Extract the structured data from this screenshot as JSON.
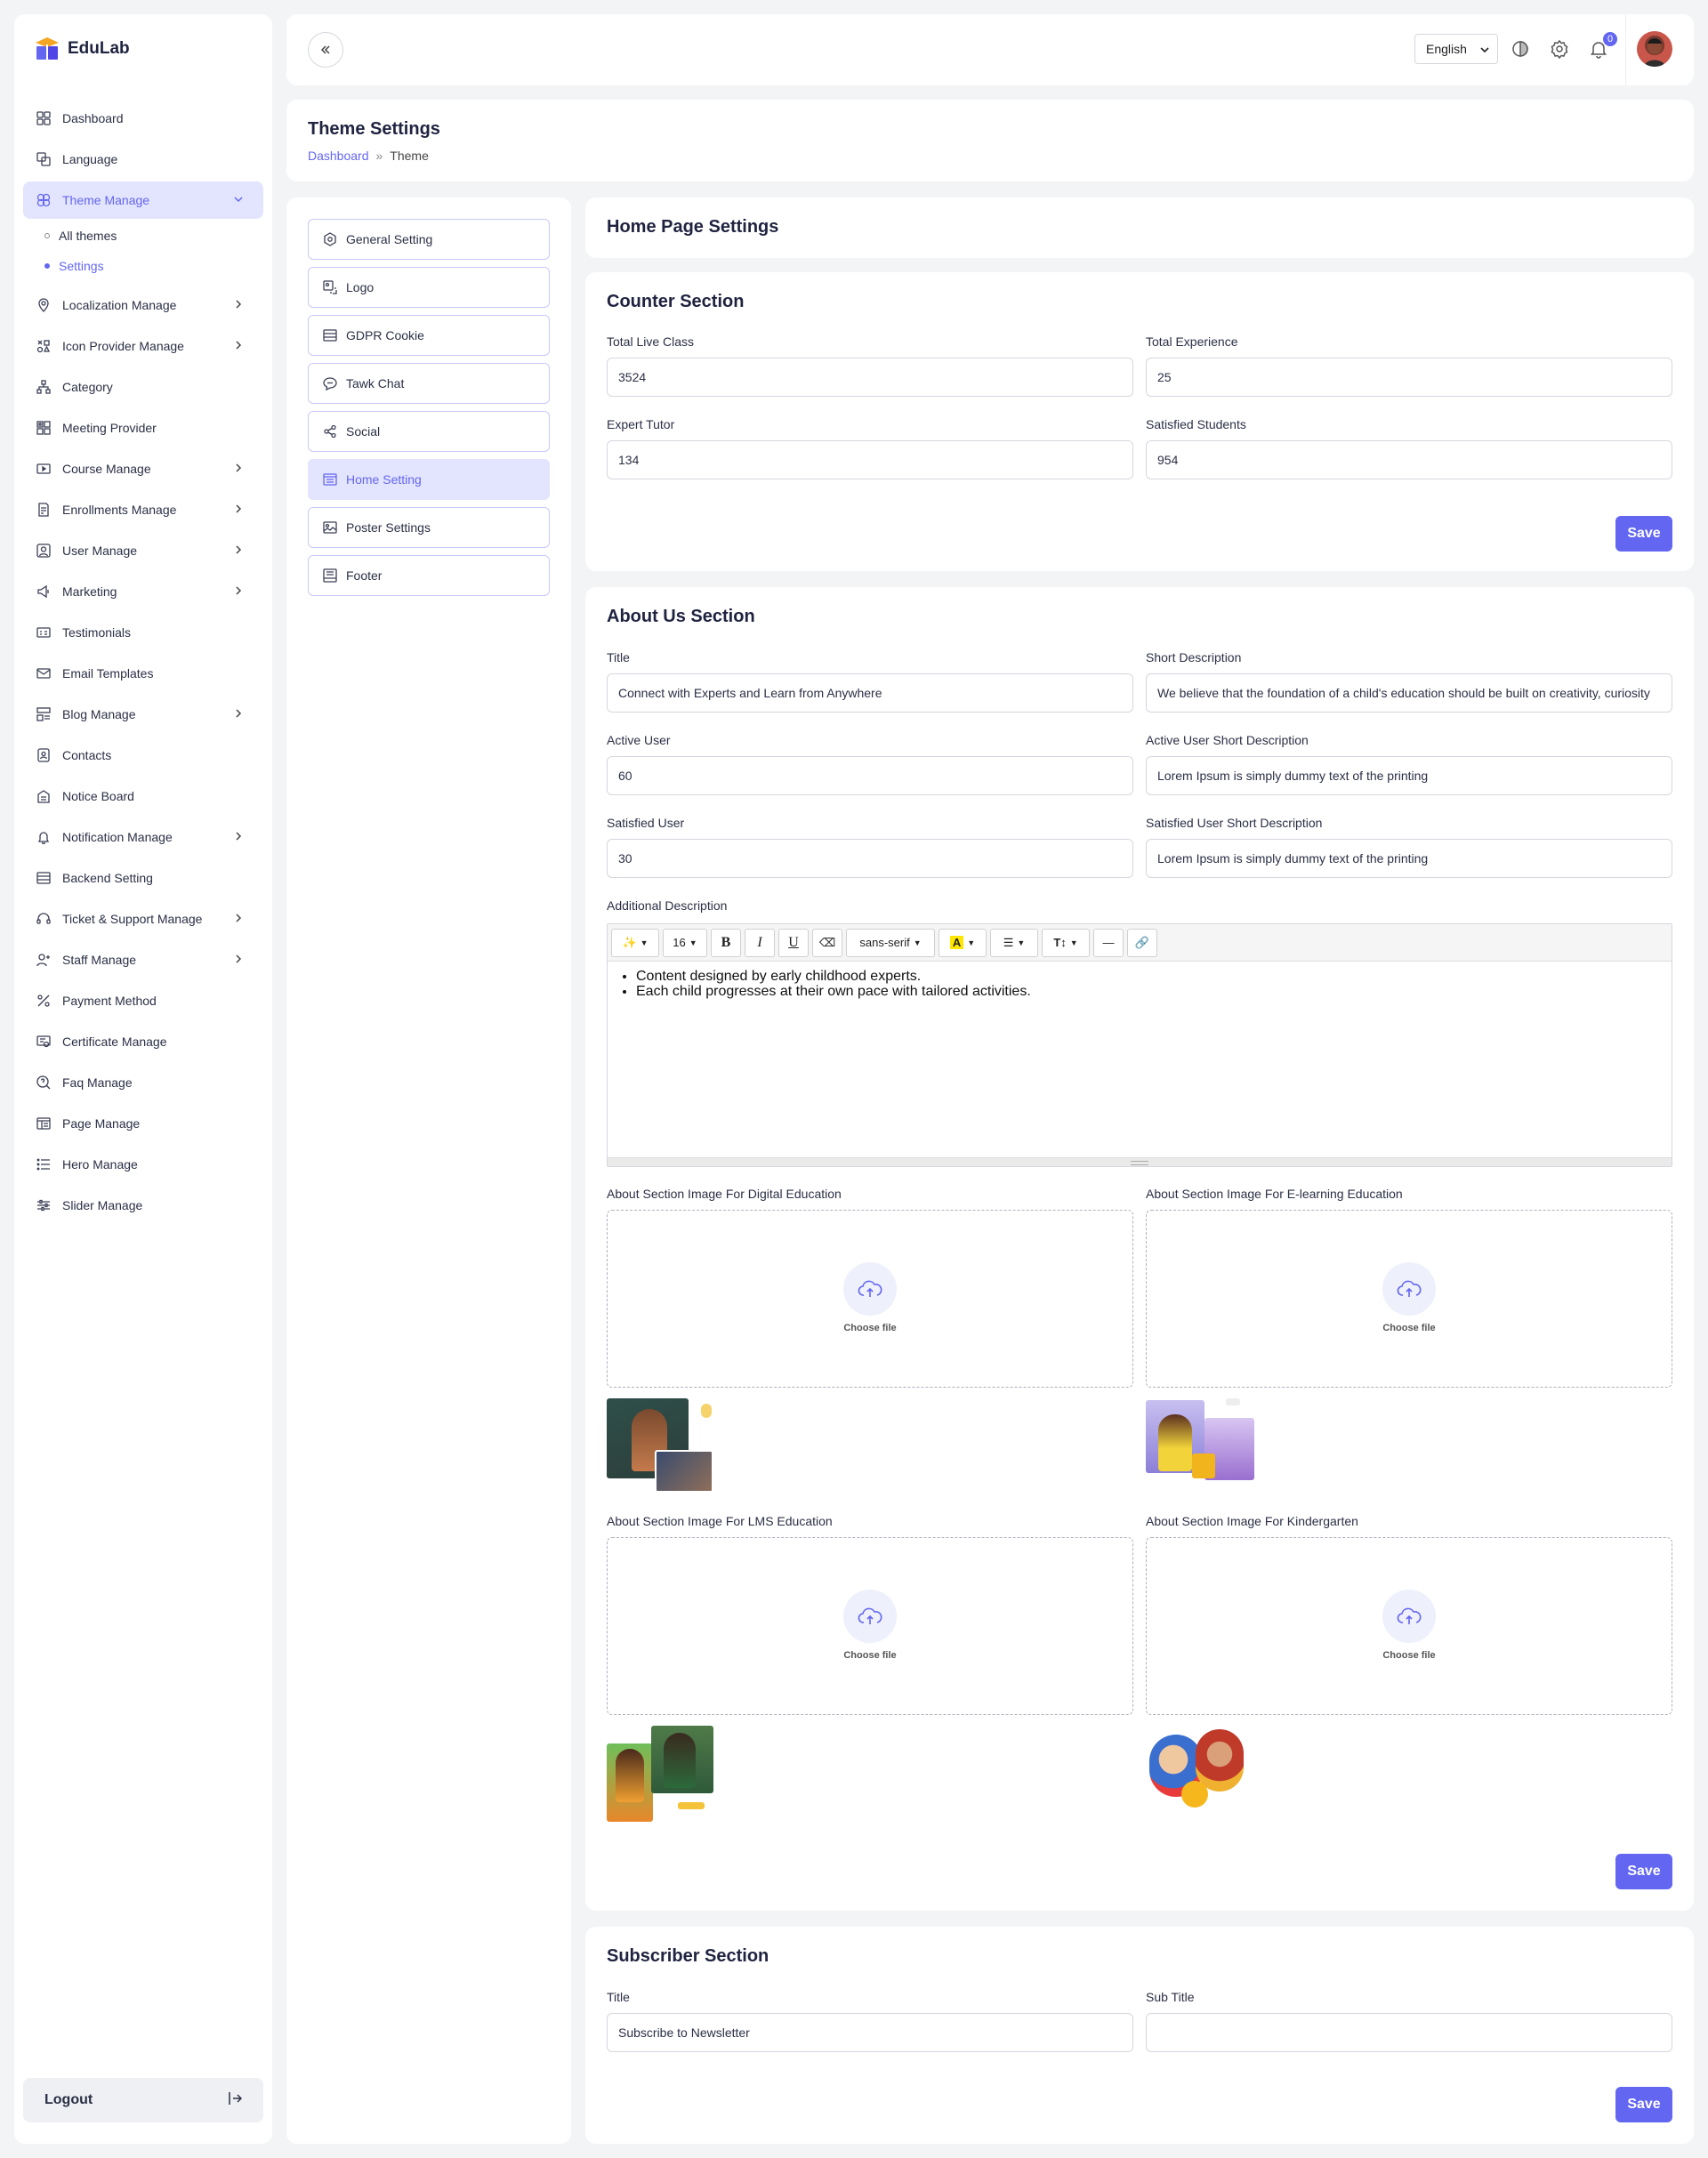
{
  "brand": {
    "name": "EduLab"
  },
  "sidebar": {
    "items": [
      {
        "label": "Dashboard",
        "icon": "dashboard-icon"
      },
      {
        "label": "Language",
        "icon": "language-icon"
      },
      {
        "label": "Theme Manage",
        "icon": "theme-icon",
        "active": true,
        "expanded": true
      },
      {
        "label": "Localization Manage",
        "icon": "localization-icon",
        "chevron": true
      },
      {
        "label": "Icon Provider Manage",
        "icon": "icon-provider-icon",
        "chevron": true
      },
      {
        "label": "Category",
        "icon": "category-icon"
      },
      {
        "label": "Meeting Provider",
        "icon": "meeting-icon"
      },
      {
        "label": "Course Manage",
        "icon": "course-icon",
        "chevron": true
      },
      {
        "label": "Enrollments Manage",
        "icon": "enrollments-icon",
        "chevron": true
      },
      {
        "label": "User Manage",
        "icon": "user-icon",
        "chevron": true
      },
      {
        "label": "Marketing",
        "icon": "megaphone-icon",
        "chevron": true
      },
      {
        "label": "Testimonials",
        "icon": "testimonials-icon"
      },
      {
        "label": "Email Templates",
        "icon": "email-icon"
      },
      {
        "label": "Blog Manage",
        "icon": "blog-icon",
        "chevron": true
      },
      {
        "label": "Contacts",
        "icon": "contacts-icon"
      },
      {
        "label": "Notice Board",
        "icon": "notice-icon"
      },
      {
        "label": "Notification Manage",
        "icon": "bell-icon",
        "chevron": true
      },
      {
        "label": "Backend Setting",
        "icon": "backend-icon"
      },
      {
        "label": "Ticket & Support Manage",
        "icon": "headset-icon",
        "chevron": true
      },
      {
        "label": "Staff Manage",
        "icon": "staff-icon",
        "chevron": true
      },
      {
        "label": "Payment Method",
        "icon": "payment-icon"
      },
      {
        "label": "Certificate Manage",
        "icon": "certificate-icon"
      },
      {
        "label": "Faq Manage",
        "icon": "faq-icon"
      },
      {
        "label": "Page Manage",
        "icon": "page-icon"
      },
      {
        "label": "Hero Manage",
        "icon": "list-icon"
      },
      {
        "label": "Slider Manage",
        "icon": "sliders-icon"
      }
    ],
    "sub_items": [
      {
        "label": "All themes"
      },
      {
        "label": "Settings",
        "active": true
      }
    ],
    "logout": "Logout"
  },
  "topbar": {
    "language": "English",
    "notification_count": "0"
  },
  "page": {
    "title": "Theme Settings",
    "breadcrumb": {
      "home": "Dashboard",
      "sep": "»",
      "current": "Theme"
    }
  },
  "settings_menu": [
    {
      "label": "General Setting",
      "icon": "gear-icon"
    },
    {
      "label": "Logo",
      "icon": "logo-icon"
    },
    {
      "label": "GDPR Cookie",
      "icon": "cookie-icon"
    },
    {
      "label": "Tawk Chat",
      "icon": "chat-icon"
    },
    {
      "label": "Social",
      "icon": "share-icon"
    },
    {
      "label": "Home Setting",
      "icon": "home-icon",
      "active": true
    },
    {
      "label": "Poster Settings",
      "icon": "poster-icon"
    },
    {
      "label": "Footer",
      "icon": "footer-icon"
    }
  ],
  "home_settings": {
    "title": "Home Page Settings"
  },
  "counter": {
    "title": "Counter Section",
    "fields": [
      {
        "label": "Total Live Class",
        "value": "3524"
      },
      {
        "label": "Total Experience",
        "value": "25"
      },
      {
        "label": "Expert Tutor",
        "value": "134"
      },
      {
        "label": "Satisfied Students",
        "value": "954"
      }
    ],
    "save": "Save"
  },
  "about": {
    "title": "About Us Section",
    "fields": [
      {
        "label": "Title",
        "value": "Connect with Experts and Learn from Anywhere"
      },
      {
        "label": "Short Description",
        "value": "We believe that the foundation of a child's education should be built on creativity, curiosity"
      },
      {
        "label": "Active User",
        "value": "60"
      },
      {
        "label": "Active User Short Description",
        "value": "Lorem Ipsum is simply dummy text of the printing"
      },
      {
        "label": "Satisfied User",
        "value": "30"
      },
      {
        "label": "Satisfied User Short Description",
        "value": "Lorem Ipsum is simply dummy text of the printing"
      }
    ],
    "additional_label": "Additional Description",
    "editor": {
      "font_size": "16",
      "font_family": "sans-serif",
      "bullets": [
        "Content designed by early childhood experts.",
        "Each child progresses at their own pace with tailored activities."
      ]
    },
    "uploads": [
      {
        "label": "About Section Image For Digital Education",
        "choose": "Choose file"
      },
      {
        "label": "About Section Image For E-learning Education",
        "choose": "Choose file"
      },
      {
        "label": "About Section Image For LMS Education",
        "choose": "Choose file"
      },
      {
        "label": "About Section Image For Kindergarten",
        "choose": "Choose file"
      }
    ],
    "save": "Save"
  },
  "subscriber": {
    "title": "Subscriber Section",
    "fields": [
      {
        "label": "Title",
        "value": "Subscribe to Newsletter"
      },
      {
        "label": "Sub Title",
        "value": ""
      }
    ],
    "save": "Save"
  },
  "colors": {
    "accent": "#6366f1",
    "accent_light": "#e3e4fd"
  }
}
